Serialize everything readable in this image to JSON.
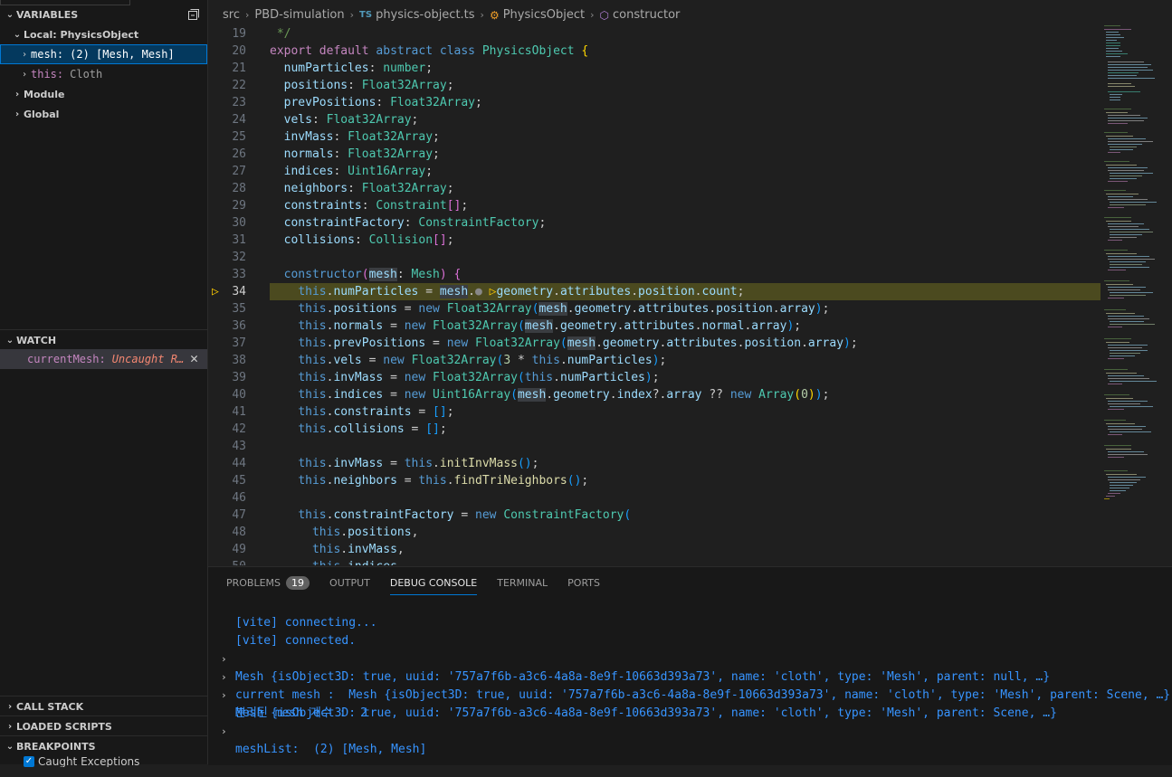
{
  "sidebar": {
    "variables_header": "VARIABLES",
    "local_label": "Local: PhysicsObject",
    "mesh_name": "mesh:",
    "mesh_value": "(2) [Mesh, Mesh]",
    "this_name": "this:",
    "this_value": "Cloth",
    "module_label": "Module",
    "global_label": "Global",
    "watch_header": "WATCH",
    "watch_name": "currentMesh:",
    "watch_value": "Uncaught R…",
    "call_stack_header": "CALL STACK",
    "loaded_scripts_header": "LOADED SCRIPTS",
    "breakpoints_header": "BREAKPOINTS",
    "caught_exceptions": "Caught Exceptions"
  },
  "breadcrumb": {
    "src": "src",
    "folder": "PBD-simulation",
    "file_badge": "TS",
    "file": "physics-object.ts",
    "class": "PhysicsObject",
    "method": "constructor"
  },
  "editor": {
    "line_numbers": [
      "19",
      "20",
      "21",
      "22",
      "23",
      "24",
      "25",
      "26",
      "27",
      "28",
      "29",
      "30",
      "31",
      "32",
      "33",
      "34",
      "35",
      "36",
      "37",
      "38",
      "39",
      "40",
      "41",
      "42",
      "43",
      "44",
      "45",
      "46",
      "47",
      "48",
      "49",
      "50"
    ],
    "active_line": "34"
  },
  "panel": {
    "tabs": {
      "problems": "PROBLEMS",
      "problems_count": "19",
      "output": "OUTPUT",
      "debug_console": "DEBUG CONSOLE",
      "terminal": "TERMINAL",
      "ports": "PORTS"
    },
    "console": [
      "[vite] connecting...",
      "[vite] connected.",
      "Mesh {isObject3D: true, uuid: '757a7f6b-a3c6-4a8a-8e9f-10663d393a73', name: 'cloth', type: 'Mesh', parent: null, …}",
      "current mesh :  Mesh {isObject3D: true, uuid: '757a7f6b-a3c6-4a8a-8e9f-10663d393a73', name: 'cloth', type: 'Mesh', parent: Scene, …}",
      "Mesh {isObject3D: true, uuid: '757a7f6b-a3c6-4a8a-8e9f-10663d393a73', name: 'cloth', type: 'Mesh', parent: Scene, …}",
      "분리된 mesh 개수 :  2",
      "meshList:  (2) [Mesh, Mesh]"
    ]
  },
  "colors": {
    "accent": "#0078d4",
    "debug_line": "#4b4a1f",
    "error_text": "#f48771",
    "console_text": "#3794ff"
  }
}
